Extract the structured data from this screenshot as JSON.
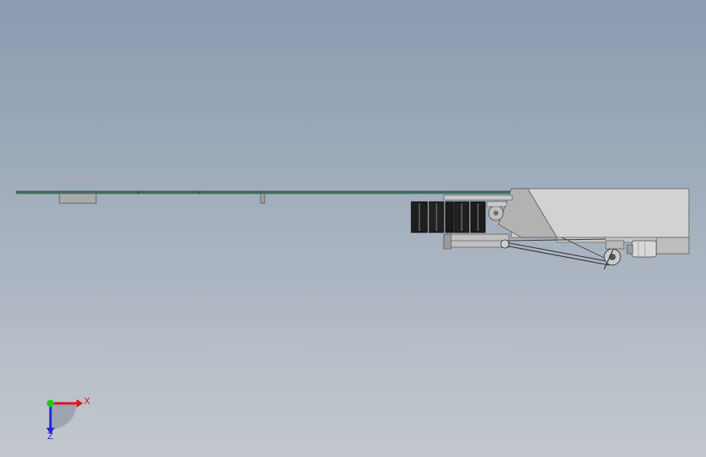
{
  "viewport": {
    "background_top": "#8a9bb0",
    "background_bottom": "#c3c8ce"
  },
  "triad": {
    "x_label": "X",
    "z_label": "Z",
    "x_color": "#e0141e",
    "y_color": "#1ec81e",
    "z_color": "#1e28d2"
  },
  "model": {
    "plate_color": "#3f7060",
    "steel_light": "#d6d6d6",
    "steel_mid": "#b4b4b4",
    "steel_dark": "#7c7c7c",
    "coil_color": "#1a1a1a"
  }
}
